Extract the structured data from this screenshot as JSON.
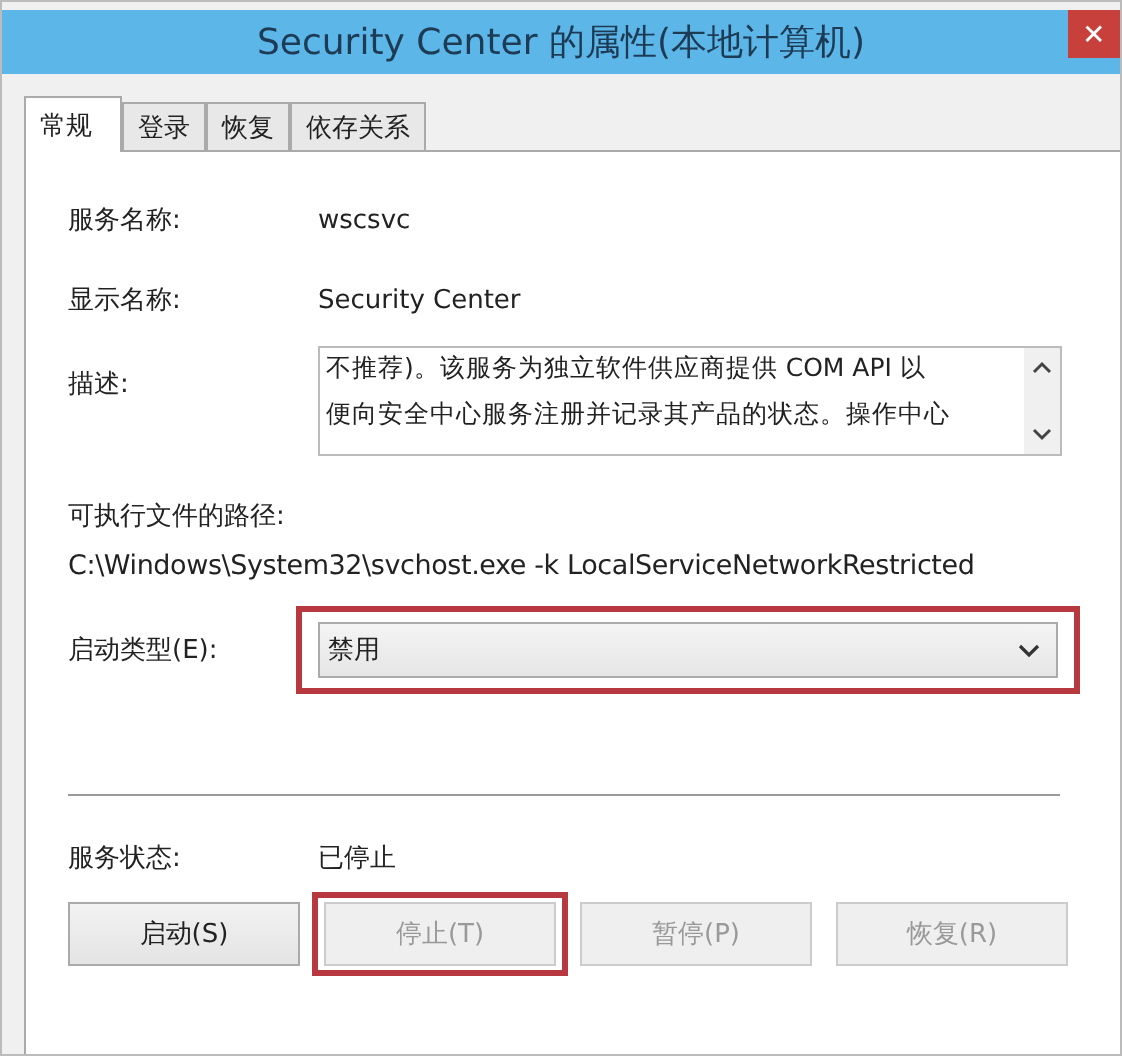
{
  "window": {
    "title": "Security Center 的属性(本地计算机)",
    "close": "✕"
  },
  "tabs": [
    {
      "label": "常规",
      "selected": true
    },
    {
      "label": "登录",
      "selected": false
    },
    {
      "label": "恢复",
      "selected": false
    },
    {
      "label": "依存关系",
      "selected": false
    }
  ],
  "service_name": {
    "label": "服务名称:",
    "value": "wscsvc"
  },
  "display_name": {
    "label": "显示名称:",
    "value": "Security Center"
  },
  "description": {
    "label": "描述:",
    "lines": [
      "不推荐)。该服务为独立软件供应商提供 COM API 以",
      "便向安全中心服务注册并记录其产品的状态。操作中心"
    ]
  },
  "executable_path": {
    "label": "可执行文件的路径:",
    "value": "C:\\Windows\\System32\\svchost.exe -k LocalServiceNetworkRestricted"
  },
  "startup_type": {
    "label": "启动类型(E):",
    "value": "禁用",
    "highlighted": true
  },
  "service_status": {
    "label": "服务状态:",
    "value": "已停止"
  },
  "buttons": [
    {
      "label": "启动(S)",
      "disabled": false,
      "highlighted": false
    },
    {
      "label": "停止(T)",
      "disabled": true,
      "highlighted": true
    },
    {
      "label": "暂停(P)",
      "disabled": true,
      "highlighted": false
    },
    {
      "label": "恢复(R)",
      "disabled": true,
      "highlighted": false
    }
  ]
}
